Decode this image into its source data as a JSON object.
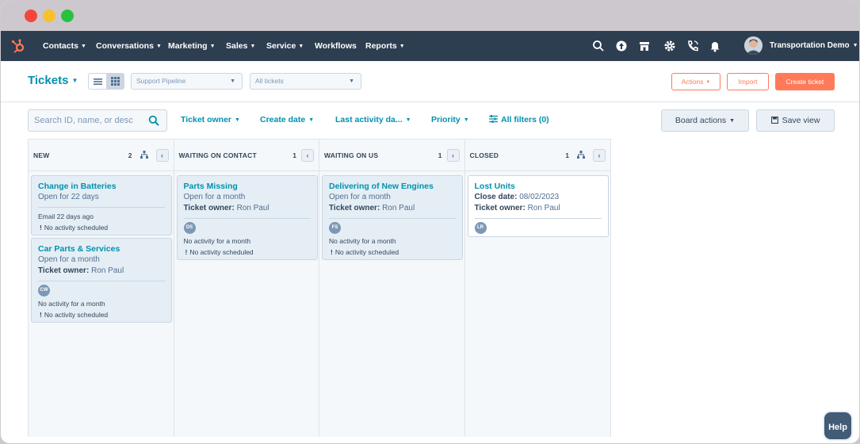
{
  "nav": {
    "items": [
      {
        "label": "Contacts",
        "caret": true
      },
      {
        "label": "Conversations",
        "caret": true
      },
      {
        "label": "Marketing",
        "caret": true
      },
      {
        "label": "Sales",
        "caret": true
      },
      {
        "label": "Service",
        "caret": true
      },
      {
        "label": "Workflows",
        "caret": false
      },
      {
        "label": "Reports",
        "caret": true
      }
    ],
    "account_name": "Transportation Demo"
  },
  "header": {
    "title": "Tickets",
    "pipeline": "Support Pipeline",
    "view": "All tickets",
    "actions_label": "Actions",
    "import_label": "Import",
    "create_label": "Create ticket"
  },
  "filters": {
    "search_placeholder": "Search ID, name, or desc",
    "ticket_owner": "Ticket owner",
    "create_date": "Create date",
    "last_activity": "Last activity da...",
    "priority": "Priority",
    "all_filters": "All filters (0)",
    "board_actions": "Board actions",
    "save_view": "Save view"
  },
  "columns": [
    {
      "title": "NEW",
      "count": "2",
      "cards": [
        {
          "title": "Change in Batteries",
          "lines": [
            "Open for 22 days"
          ],
          "owner": null,
          "avatar": null,
          "activity": [
            "Email 22 days ago",
            "No activity scheduled"
          ]
        },
        {
          "title": "Car Parts & Services",
          "lines": [
            "Open for a month"
          ],
          "owner": "Ron Paul",
          "avatar": "CW",
          "activity": [
            "No activity for a month",
            "No activity scheduled"
          ]
        }
      ]
    },
    {
      "title": "WAITING ON CONTACT",
      "count": "1",
      "cards": [
        {
          "title": "Parts Missing",
          "lines": [
            "Open for a month"
          ],
          "owner": "Ron Paul",
          "avatar": "DS",
          "activity": [
            "No activity for a month",
            "No activity scheduled"
          ]
        }
      ]
    },
    {
      "title": "WAITING ON US",
      "count": "1",
      "cards": [
        {
          "title": "Delivering of New Engines",
          "lines": [
            "Open for a month"
          ],
          "owner": "Ron Paul",
          "avatar": "FS",
          "activity": [
            "No activity for a month",
            "No activity scheduled"
          ]
        }
      ]
    },
    {
      "title": "CLOSED",
      "count": "1",
      "cards": [
        {
          "title": "Lost Units",
          "close_date": "08/02/2023",
          "owner": "Ron Paul",
          "avatar": "LR",
          "activity": []
        }
      ]
    }
  ],
  "labels": {
    "ticket_owner_prefix": "Ticket owner:",
    "close_date_prefix": "Close date:"
  },
  "help_label": "Help",
  "colors": {
    "nav_bg": "#2d3e50",
    "accent_teal": "#0091ae",
    "accent_orange": "#ff7a59",
    "card_bg": "#e5eef5"
  }
}
